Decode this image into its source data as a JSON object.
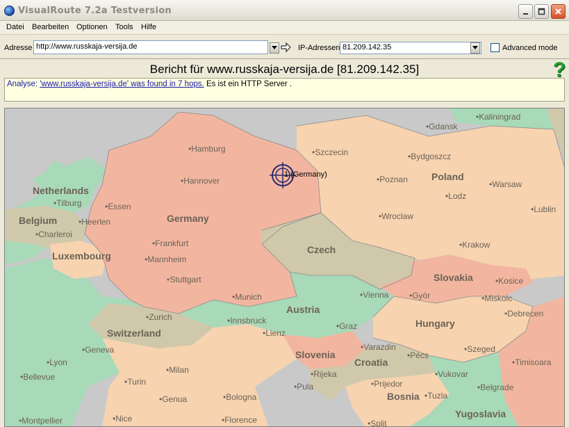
{
  "window": {
    "title": "VisualRoute 7.2a Testversion"
  },
  "menu": [
    "Datei",
    "Bearbeiten",
    "Optionen",
    "Tools",
    "Hilfe"
  ],
  "address_bar": {
    "address_label": "Adresse",
    "address_value": "http://www.russkaja-versija.de",
    "ip_label": "IP-Adressen",
    "ip_value": "81.209.142.35",
    "advanced_label": "Advanced mode",
    "advanced_checked": false
  },
  "report": {
    "title": "Bericht für www.russkaja-versija.de [81.209.142.35]"
  },
  "analysis": {
    "prefix": "Analyse:",
    "link_text": "'www.russkaja-versija.de' was found in 7 hops.",
    "suffix": "Es ist ein HTTP Server ."
  },
  "map": {
    "hop_label": "1 (Germany)",
    "countries": [
      "Netherlands",
      "Belgium",
      "Luxembourg",
      "Germany",
      "Poland",
      "Czech",
      "Slovakia",
      "Austria",
      "Hungary",
      "Switzerland",
      "Slovenia",
      "Croatia",
      "Bosnia",
      "Yugoslavia"
    ],
    "cities": [
      "Kaliningrad",
      "Gdansk",
      "Hamburg",
      "Szczecin",
      "Bydgoszcz",
      "Hannover",
      "Poznan",
      "Warsaw",
      "Tilburg",
      "Essen",
      "Heerlen",
      "Lodz",
      "Lublin",
      "Charleroi",
      "Wroclaw",
      "Frankfurt",
      "Krakow",
      "Mannheim",
      "Stuttgart",
      "Kosice",
      "Munich",
      "Vienna",
      "Györ",
      "Miskolc",
      "Zurich",
      "Innsbruck",
      "Debrecen",
      "Graz",
      "Lienz",
      "Geneva",
      "Varazdin",
      "Szeged",
      "Lyon",
      "Milan",
      "Pécs",
      "Timisoara",
      "Bellevue",
      "Turin",
      "Rijeka",
      "Vukovar",
      "Prijedor",
      "Belgrade",
      "Pula",
      "Genua",
      "Bologna",
      "Tuzla",
      "Montpellier",
      "Nice",
      "Florence",
      "Split"
    ]
  },
  "colors": {
    "germany": "#f2b6a0",
    "poland": "#f7d3b0",
    "czech": "#cfc8aa",
    "austria": "#a8d9b8",
    "slovakia": "#f2b6a0",
    "hungary": "#f7d3b0",
    "help_icon": "#1f9d2a"
  }
}
